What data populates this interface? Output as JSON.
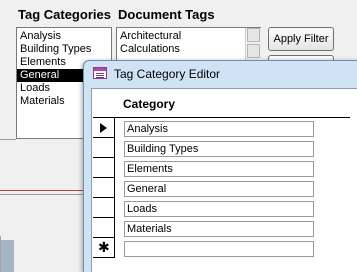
{
  "headers": {
    "tag_categories": "Tag Categories",
    "document_tags": "Document Tags"
  },
  "tag_categories": {
    "items": [
      "Analysis",
      "Building Types",
      "Elements",
      "General",
      "Loads",
      "Materials"
    ],
    "selected": "General"
  },
  "document_tags": {
    "items": [
      "Architectural",
      "Calculations"
    ]
  },
  "buttons": {
    "apply_filter": "Apply Filter"
  },
  "editor": {
    "title": "Tag Category Editor",
    "column_header": "Category",
    "rows": [
      "Analysis",
      "Building Types",
      "Elements",
      "General",
      "Loads",
      "Materials"
    ],
    "new_row_marker": "✱"
  },
  "colors": {
    "selected_bg": "#000000",
    "title_bar": "#cfe3f5",
    "accent_line": "#c0402f"
  }
}
